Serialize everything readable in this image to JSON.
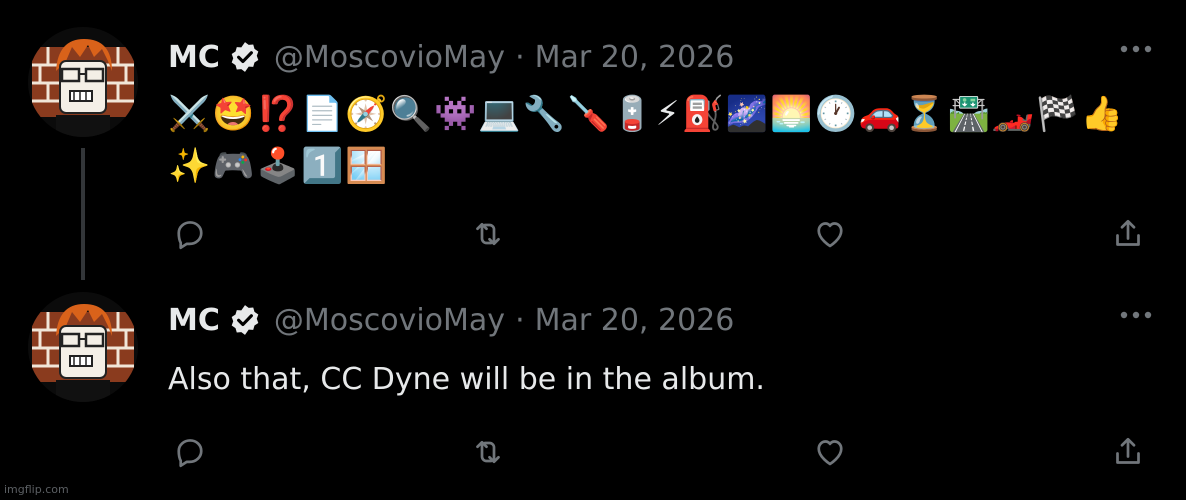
{
  "colors": {
    "background": "#000000",
    "text": "#e7e9ea",
    "muted": "#71767b",
    "thread_line": "#333639"
  },
  "tweets": [
    {
      "name": "MC",
      "handle": "@MoscovioMay",
      "separator": "·",
      "date": "Mar 20, 2026",
      "text": "⚔️🤩⁉️📄🧭🔍👾💻🔧🪛🪫⚡⛽🌌🌅🕐🚗⏳🛣️🏎️🏁👍✨🎮🕹️1️⃣🪟",
      "icons": {
        "verified": "verified-badge-icon",
        "more": "more-icon",
        "reply": "reply-icon",
        "retweet": "retweet-icon",
        "like": "like-icon",
        "share": "share-icon"
      }
    },
    {
      "name": "MC",
      "handle": "@MoscovioMay",
      "separator": "·",
      "date": "Mar 20, 2026",
      "text": "Also that, CC Dyne will be in the album.",
      "icons": {
        "verified": "verified-badge-icon",
        "more": "more-icon",
        "reply": "reply-icon",
        "retweet": "retweet-icon",
        "like": "like-icon",
        "share": "share-icon"
      }
    }
  ],
  "watermark": "imgflip.com"
}
